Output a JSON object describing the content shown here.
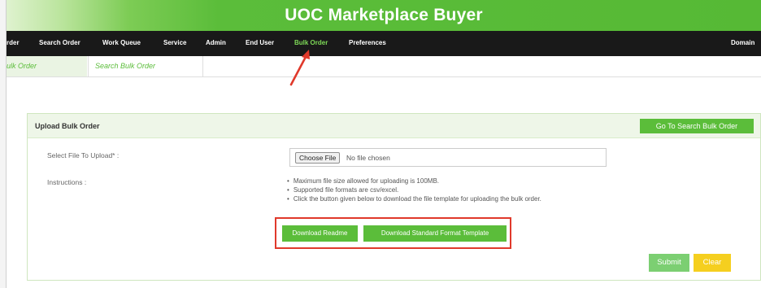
{
  "header": {
    "title": "UOC Marketplace Buyer",
    "gradient_color": "#5bbd3a"
  },
  "navbar": {
    "items": [
      {
        "label": "rder"
      },
      {
        "label": "Search Order"
      },
      {
        "label": "Work Queue"
      },
      {
        "label": "Service"
      },
      {
        "label": "Admin"
      },
      {
        "label": "End User"
      },
      {
        "label": "Bulk Order",
        "active": true
      },
      {
        "label": "Preferences"
      },
      {
        "label": "Domain"
      }
    ],
    "active_color": "#7ed957"
  },
  "tabs": [
    {
      "label": "ulk Order",
      "active": true
    },
    {
      "label": "Search Bulk Order"
    }
  ],
  "annotation": {
    "arrow_icon": "red-arrow-icon",
    "color": "#e0392b"
  },
  "panel": {
    "title": "Upload Bulk Order",
    "goto_button": "Go To Search Bulk Order",
    "file_label": "Select File To Upload* :",
    "choose_file_button": "Choose File",
    "no_file_text": "No file chosen",
    "instructions_label": "Instructions :",
    "instructions": [
      "Maximum file size allowed for uploading is 100MB.",
      "Supported file formats are csv/excel.",
      "Click the button given below to download the file template for uploading the bulk order."
    ],
    "download_readme": "Download Readme",
    "download_template": "Download Standard Format Template",
    "submit": "Submit",
    "clear": "Clear"
  },
  "colors": {
    "green": "#5bbd3a",
    "yellow": "#f5cf1f",
    "highlight": "#e0392b"
  }
}
